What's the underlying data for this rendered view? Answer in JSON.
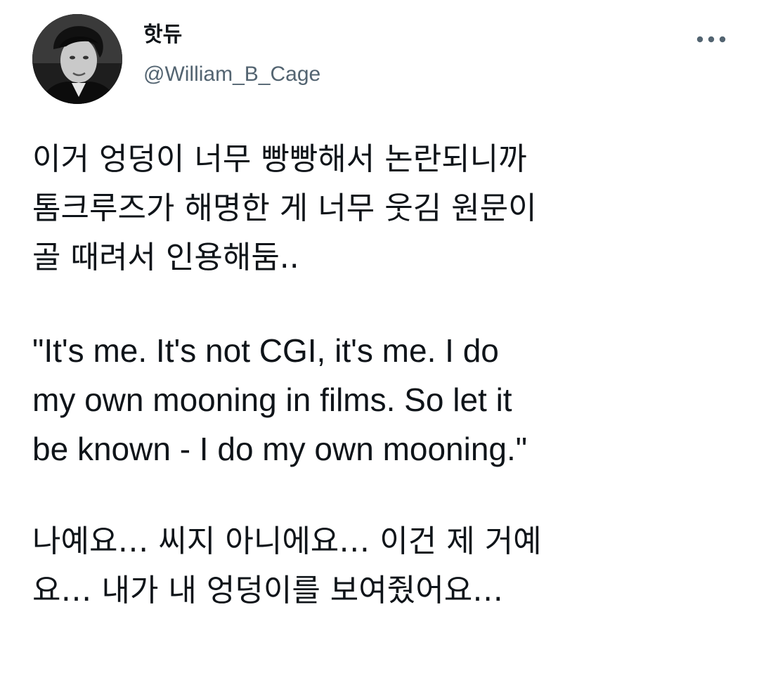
{
  "author": {
    "display_name": "핫듀",
    "handle": "@William_B_Cage",
    "avatar_icon": "avatar-photo"
  },
  "more_icon": "more-horizontal-icon",
  "tweet": {
    "paragraph_1": "이거 엉덩이 너무 빵빵해서 논란되니까\n톰크루즈가 해명한 게 너무 웃김 원문이\n골 때려서 인용해둠..",
    "paragraph_2": "\"It's me. It's not CGI, it's me. I do\nmy own mooning in films. So let it\nbe known - I do my own mooning.\"",
    "paragraph_3": "나예요… 씨지 아니에요… 이건 제 거예\n요… 내가 내 엉덩이를 보여줬어요…"
  },
  "colors": {
    "text": "#0f1419",
    "secondary": "#536471",
    "background": "#ffffff"
  }
}
